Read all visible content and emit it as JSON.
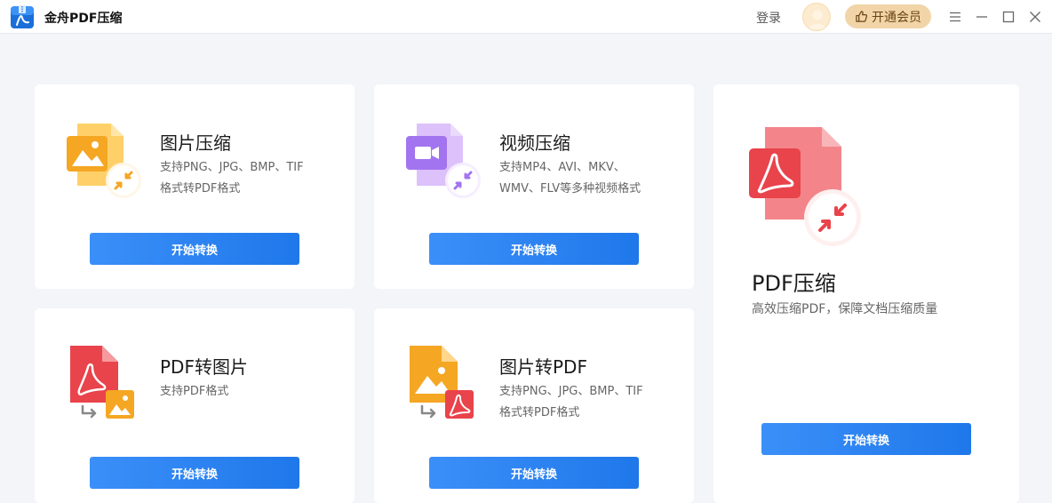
{
  "app": {
    "title": "金舟PDF压缩",
    "logo_icon": "pdf-compress-logo-icon"
  },
  "header": {
    "login_label": "登录",
    "vip_label": "开通会员",
    "avatar_icon": "user-avatar-icon",
    "vip_icon": "thumbs-up-icon",
    "window_controls": [
      "menu-icon",
      "minimize-icon",
      "maximize-icon",
      "close-icon"
    ]
  },
  "colors": {
    "primary_button": "#2584f0",
    "vip_bg": "#f1d5a8",
    "image_icon": "#f5a623",
    "video_icon": "#a274f0",
    "pdf_icon": "#e9434b"
  },
  "cards": [
    {
      "id": "image-compress",
      "title": "图片压缩",
      "desc_lines": [
        "支持PNG、JPG、BMP、TIF",
        "格式转PDF格式"
      ],
      "button": "开始转换",
      "icon": "image-compress-icon"
    },
    {
      "id": "video-compress",
      "title": "视频压缩",
      "desc_lines": [
        "支持MP4、AVI、MKV、",
        "WMV、FLV等多种视频格式"
      ],
      "button": "开始转换",
      "icon": "video-compress-icon"
    },
    {
      "id": "pdf-compress",
      "title": "PDF压缩",
      "desc_lines": [
        "高效压缩PDF，保障文档压缩质量"
      ],
      "button": "开始转换",
      "icon": "pdf-compress-icon"
    },
    {
      "id": "pdf-to-image",
      "title": "PDF转图片",
      "desc_lines": [
        "支持PDF格式"
      ],
      "button": "开始转换",
      "icon": "pdf-to-image-icon"
    },
    {
      "id": "image-to-pdf",
      "title": "图片转PDF",
      "desc_lines": [
        "支持PNG、JPG、BMP、TIF",
        "格式转PDF格式"
      ],
      "button": "开始转换",
      "icon": "image-to-pdf-icon"
    }
  ]
}
